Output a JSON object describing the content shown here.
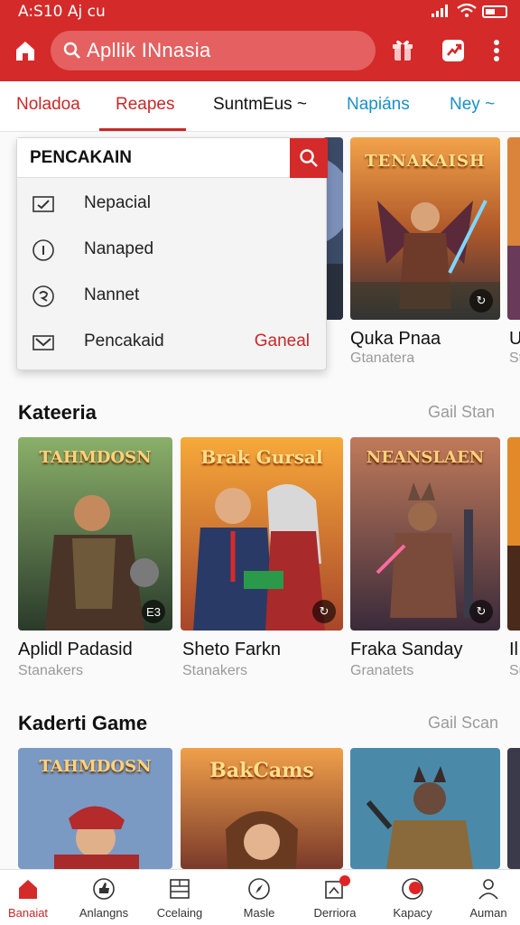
{
  "status_bar": {
    "time": "A:S10 Aj cu"
  },
  "header": {
    "search_label": "Apllik INnasia",
    "icons": [
      "home-icon",
      "search-icon",
      "gift-icon",
      "share-icon",
      "more-vertical-icon"
    ]
  },
  "tabs": [
    {
      "label": "Noladoa",
      "color": "#c82828"
    },
    {
      "label": "Reapes",
      "color": "#c82828",
      "selected": true
    },
    {
      "label": "SuntmEus ~",
      "color": "#111111"
    },
    {
      "label": "Napiáns",
      "color": "#1a8fc7"
    },
    {
      "label": "Ney ~",
      "color": "#1a8fc7"
    }
  ],
  "dropdown": {
    "header": "PENCAKAIN",
    "items": [
      {
        "label": "Nepacial",
        "icon": "check-box-icon"
      },
      {
        "label": "Nanaped",
        "icon": "info-circle-icon"
      },
      {
        "label": "Nannet",
        "icon": "refresh-circle-icon"
      },
      {
        "label": "Pencakaid",
        "icon": "mail-box-icon",
        "action": "Ganeal"
      }
    ]
  },
  "featured": [
    {
      "art_title": "TENAKAISH",
      "title": "Quka Pnaa",
      "subtitle": "Gtanatera",
      "badge": "↻"
    },
    {
      "art_title": "",
      "title": "U",
      "subtitle": "St",
      "badge": ""
    }
  ],
  "sections": [
    {
      "title": "Kateeria",
      "link": "Gail Stan",
      "cards": [
        {
          "art_title": "TAHMDOSN",
          "title": "Aplidl Padasid",
          "subtitle": "Stanakers",
          "badge": "E3"
        },
        {
          "art_title": "Brak Gursal",
          "title": "Sheto Farkn",
          "subtitle": "Stanakers",
          "badge": "↻"
        },
        {
          "art_title": "NEANSLAEN",
          "title": "Fraka Sanday",
          "subtitle": "Granatets",
          "badge": "↻"
        },
        {
          "art_title": "",
          "title": "Il",
          "subtitle": "Su",
          "badge": ""
        }
      ]
    },
    {
      "title": "Kaderti Game",
      "link": "Gail Scan",
      "cards": [
        {
          "art_title": "TAHMDOSN",
          "title": "",
          "subtitle": "",
          "badge": ""
        },
        {
          "art_title": "BakCams",
          "title": "",
          "subtitle": "",
          "badge": ""
        },
        {
          "art_title": "",
          "title": "",
          "subtitle": "",
          "badge": ""
        },
        {
          "art_title": "",
          "title": "",
          "subtitle": "",
          "badge": ""
        }
      ]
    }
  ],
  "bottom_nav": [
    {
      "label": "Banaiat",
      "icon": "home-icon",
      "active": true
    },
    {
      "label": "Anlangns",
      "icon": "thumbs-up-icon"
    },
    {
      "label": "Ccelaing",
      "icon": "list-icon"
    },
    {
      "label": "Masle",
      "icon": "compass-icon"
    },
    {
      "label": "Derriora",
      "icon": "notification-icon",
      "dot": true
    },
    {
      "label": "Kapacy",
      "icon": "profile-badge-icon",
      "dot": true
    },
    {
      "label": "Auman",
      "icon": "person-icon"
    }
  ],
  "colors": {
    "brand_red": "#d42a2a",
    "link_blue": "#1a8fc7",
    "muted_gray": "#9a9a9a"
  }
}
